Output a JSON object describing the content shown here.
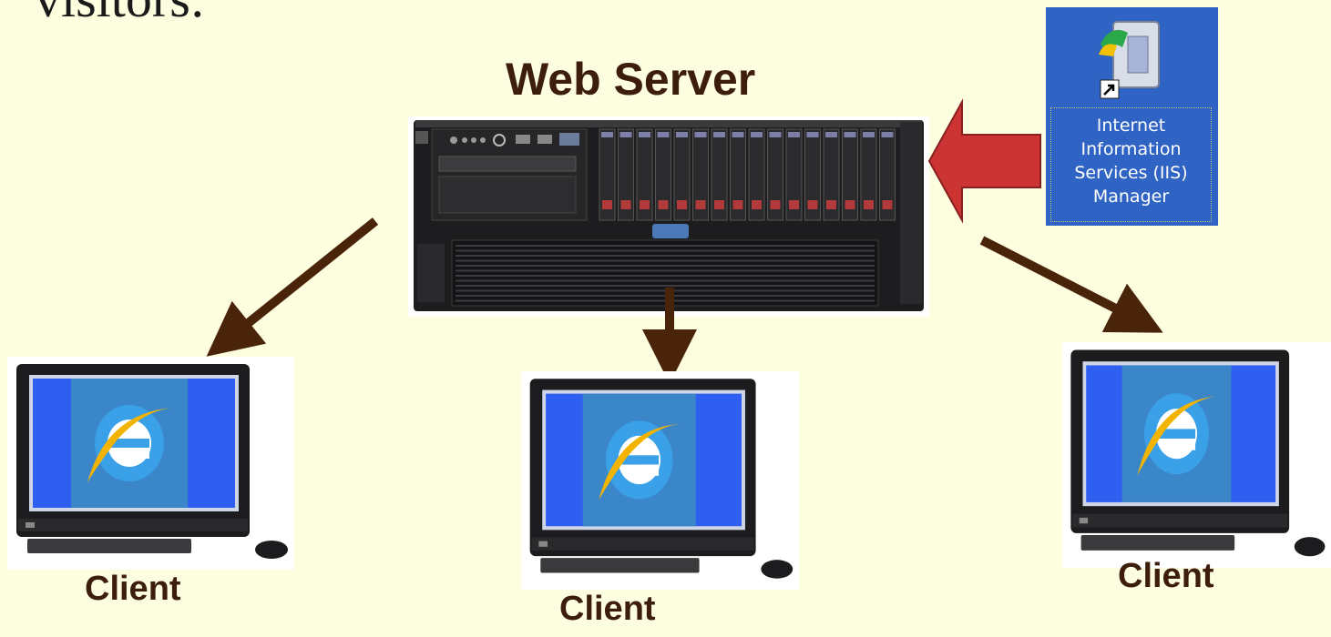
{
  "heading_fragment": "visitors:",
  "server": {
    "title": "Web Server",
    "icon": "rack-server-image"
  },
  "iis_shortcut": {
    "icon": "iis-manager-shortcut-icon",
    "label_lines": [
      "Internet",
      "Information",
      "Services (IIS)",
      "Manager"
    ],
    "tile_color": "#2f64c4"
  },
  "clients": [
    {
      "label": "Client",
      "icon": "desktop-computer-ie-icon"
    },
    {
      "label": "Client",
      "icon": "desktop-computer-ie-icon"
    },
    {
      "label": "Client",
      "icon": "desktop-computer-ie-icon"
    }
  ],
  "colors": {
    "background": "#fdfde0",
    "arrow_brown": "#4a2408",
    "arrow_red": "#cc3333",
    "screen_blue": "#2f5ff0",
    "text_brown": "#3d1e0c"
  }
}
